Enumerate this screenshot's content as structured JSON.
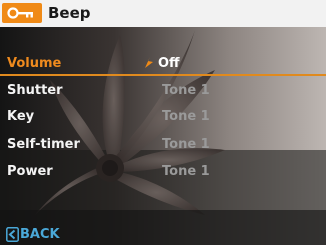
{
  "header": {
    "title": "Beep",
    "icon": "key-icon",
    "accent_color": "#f08a16"
  },
  "menu": {
    "selected_index": 0,
    "items": [
      {
        "label": "Volume",
        "value": "Off"
      },
      {
        "label": "Shutter",
        "value": "Tone 1"
      },
      {
        "label": "Key",
        "value": "Tone 1"
      },
      {
        "label": "Self-timer",
        "value": "Tone 1"
      },
      {
        "label": "Power",
        "value": "Tone 1"
      }
    ],
    "selected_color": "#ee8a1e"
  },
  "footer": {
    "back_label": "BACK",
    "back_icon": "back-arrow-icon",
    "color": "#4aa8d8"
  }
}
